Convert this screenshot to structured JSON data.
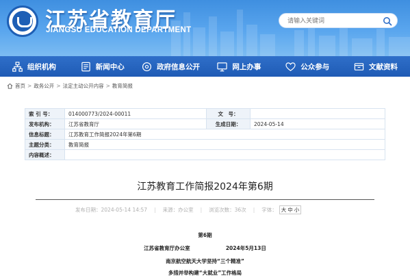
{
  "header": {
    "site_title": "江苏省教育厅",
    "site_subtitle": "JIANGSU EDUCATION DEPARTMENT",
    "search_placeholder": "请输入关键词",
    "brand_color": "#2f6fc9"
  },
  "nav": {
    "items": [
      {
        "label": "组织机构",
        "icon": "org-chart-icon"
      },
      {
        "label": "新闻中心",
        "icon": "news-icon"
      },
      {
        "label": "政府信息公开",
        "icon": "info-disclosure-icon"
      },
      {
        "label": "网上办事",
        "icon": "online-service-icon"
      },
      {
        "label": "公众参与",
        "icon": "public-participation-icon"
      },
      {
        "label": "文献资料",
        "icon": "documents-icon"
      }
    ]
  },
  "breadcrumb": {
    "items": [
      "首页",
      "政务公开",
      "法定主动公开内容",
      "教育简报"
    ],
    "separator": ">"
  },
  "info_table": {
    "index_label": "索 引 号：",
    "index_value": "014000773/2024-00011",
    "docno_label": "文　号：",
    "docno_value": "",
    "publisher_label": "发布机构：",
    "publisher_value": "江苏省教育厅",
    "date_label": "生成日期：",
    "date_value": "2024-05-14",
    "name_label": "信息标题：",
    "name_value": "江苏教育工作简报2024年第6期",
    "topic_label": "主题分类：",
    "topic_value": "教育简报",
    "summary_label": "内容概述：",
    "summary_value": ""
  },
  "article": {
    "title": "江苏教育工作简报2024年第6期",
    "meta_date": "发布日期：2024-05-14 14:57",
    "meta_source": "来源：办公室",
    "meta_views": "浏览次数：36次",
    "font_size_label": "字体：",
    "font_sizes": [
      "大",
      "中",
      "小"
    ],
    "lines": [
      "第6期",
      "江苏省教育厅办公室                    2024年5月13日",
      "南京航空航天大学坚持“三个精准”",
      "多措并举构建“大就业”工作格局"
    ]
  }
}
